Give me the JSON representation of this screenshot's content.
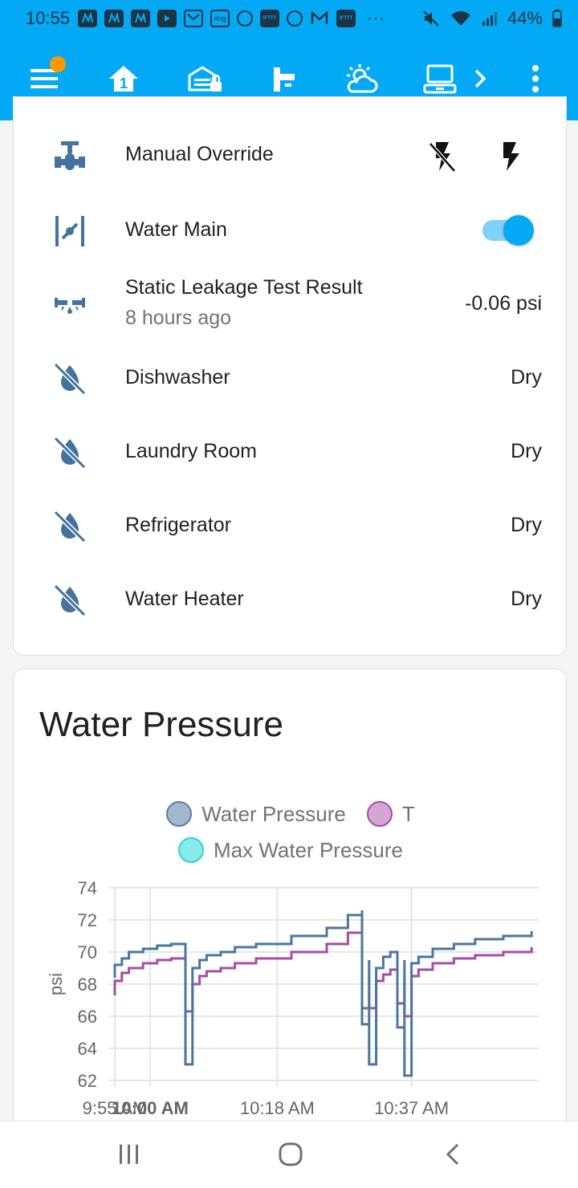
{
  "status_bar": {
    "time": "10:55",
    "notification_icons": [
      "nest-icon",
      "nest-icon",
      "nest-icon",
      "youtube-icon",
      "mail-icon",
      "ring-icon",
      "gear-icon",
      "ifttt-icon",
      "gear-icon",
      "gmail-icon",
      "ifttt-icon"
    ],
    "ring_text": "ring",
    "ifttt_text": "IFTTT",
    "more": "···",
    "battery": "44%"
  },
  "toolbar": {
    "menu_icon": "hamburger-menu-icon",
    "tabs": [
      {
        "icon": "home-icon",
        "active": true
      },
      {
        "icon": "garage-lock-icon",
        "active": false
      },
      {
        "icon": "faucet-icon",
        "active": false
      },
      {
        "icon": "weather-partly-cloudy-icon",
        "active": false
      },
      {
        "icon": "laptop-icon",
        "active": false
      }
    ],
    "scroll_icon": "chevron-right-icon",
    "overflow_icon": "dots-vertical-icon"
  },
  "entities": [
    {
      "name": "Manual Override",
      "icon": "valve-icon",
      "actions": [
        "flash-off-icon",
        "flash-icon"
      ]
    },
    {
      "name": "Water Main",
      "icon": "valve-open-icon",
      "toggle": true
    },
    {
      "name": "Static Leakage Test Result",
      "secondary": "8 hours ago",
      "icon": "pipe-leak-icon",
      "state": "-0.06 psi"
    },
    {
      "name": "Dishwasher",
      "icon": "water-off-icon",
      "state": "Dry"
    },
    {
      "name": "Laundry Room",
      "icon": "water-off-icon",
      "state": "Dry"
    },
    {
      "name": "Refrigerator",
      "icon": "water-off-icon",
      "state": "Dry"
    },
    {
      "name": "Water Heater",
      "icon": "water-off-icon",
      "state": "Dry"
    }
  ],
  "chart_card": {
    "title": "Water Pressure",
    "legend": [
      {
        "label": "Water Pressure",
        "color": "#4b76a1"
      },
      {
        "label": "T",
        "color": "#a64ca6"
      },
      {
        "label": "Max Water Pressure",
        "color": "#2ed3d3"
      }
    ]
  },
  "chart_data": {
    "type": "line",
    "title": "Water Pressure",
    "ylabel": "psi",
    "ylim": [
      62,
      74
    ],
    "yticks": [
      62,
      64,
      66,
      68,
      70,
      72,
      74
    ],
    "xticks": [
      "9:55 AM",
      "10:00 AM",
      "10:18 AM",
      "10:37 AM"
    ],
    "grid": true,
    "legend_position": "top",
    "series": [
      {
        "name": "Water Pressure",
        "color": "#4b76a1",
        "x": [
          "9:55",
          "9:55",
          "9:56",
          "9:57",
          "9:59",
          "10:01",
          "10:03",
          "10:05",
          "10:05",
          "10:06",
          "10:07",
          "10:08",
          "10:10",
          "10:12",
          "10:15",
          "10:20",
          "10:25",
          "10:28",
          "10:30",
          "10:30",
          "10:31",
          "10:31",
          "10:32",
          "10:33",
          "10:34",
          "10:35",
          "10:35",
          "10:36",
          "10:36",
          "10:37",
          "10:37",
          "10:38",
          "10:40",
          "10:43",
          "10:46",
          "10:50",
          "10:54"
        ],
        "y": [
          68.4,
          69.2,
          69.6,
          70.0,
          70.2,
          70.4,
          70.5,
          70.5,
          63.0,
          69.0,
          69.5,
          69.8,
          70.0,
          70.3,
          70.5,
          71.0,
          71.5,
          72.3,
          72.6,
          65.5,
          69.5,
          63.0,
          69.0,
          69.7,
          70.0,
          69.8,
          65.3,
          69.5,
          62.3,
          68.5,
          69.3,
          69.7,
          70.2,
          70.5,
          70.8,
          71.0,
          71.3
        ]
      },
      {
        "name": "T",
        "color": "#a64ca6",
        "x": [
          "9:55",
          "9:55",
          "9:56",
          "9:57",
          "9:59",
          "10:01",
          "10:03",
          "10:05",
          "10:05",
          "10:06",
          "10:07",
          "10:08",
          "10:10",
          "10:12",
          "10:15",
          "10:20",
          "10:25",
          "10:28",
          "10:30",
          "10:30",
          "10:31",
          "10:31",
          "10:32",
          "10:33",
          "10:34",
          "10:35",
          "10:35",
          "10:36",
          "10:36",
          "10:37",
          "10:37",
          "10:38",
          "10:40",
          "10:43",
          "10:46",
          "10:50",
          "10:54"
        ],
        "y": [
          67.3,
          68.2,
          68.7,
          69.0,
          69.3,
          69.5,
          69.6,
          69.6,
          66.3,
          68.0,
          68.5,
          68.8,
          69.0,
          69.3,
          69.6,
          70.0,
          70.5,
          71.2,
          71.5,
          66.5,
          68.5,
          66.5,
          68.2,
          68.6,
          68.9,
          68.7,
          66.8,
          68.5,
          66.0,
          67.8,
          68.5,
          68.9,
          69.3,
          69.6,
          69.8,
          70.0,
          70.3
        ]
      }
    ]
  },
  "navbar": {
    "buttons": [
      {
        "name": "recent-apps-button",
        "icon": "recents-icon"
      },
      {
        "name": "home-button",
        "icon": "home-circle-icon"
      },
      {
        "name": "back-button",
        "icon": "back-chevron-icon"
      }
    ]
  }
}
